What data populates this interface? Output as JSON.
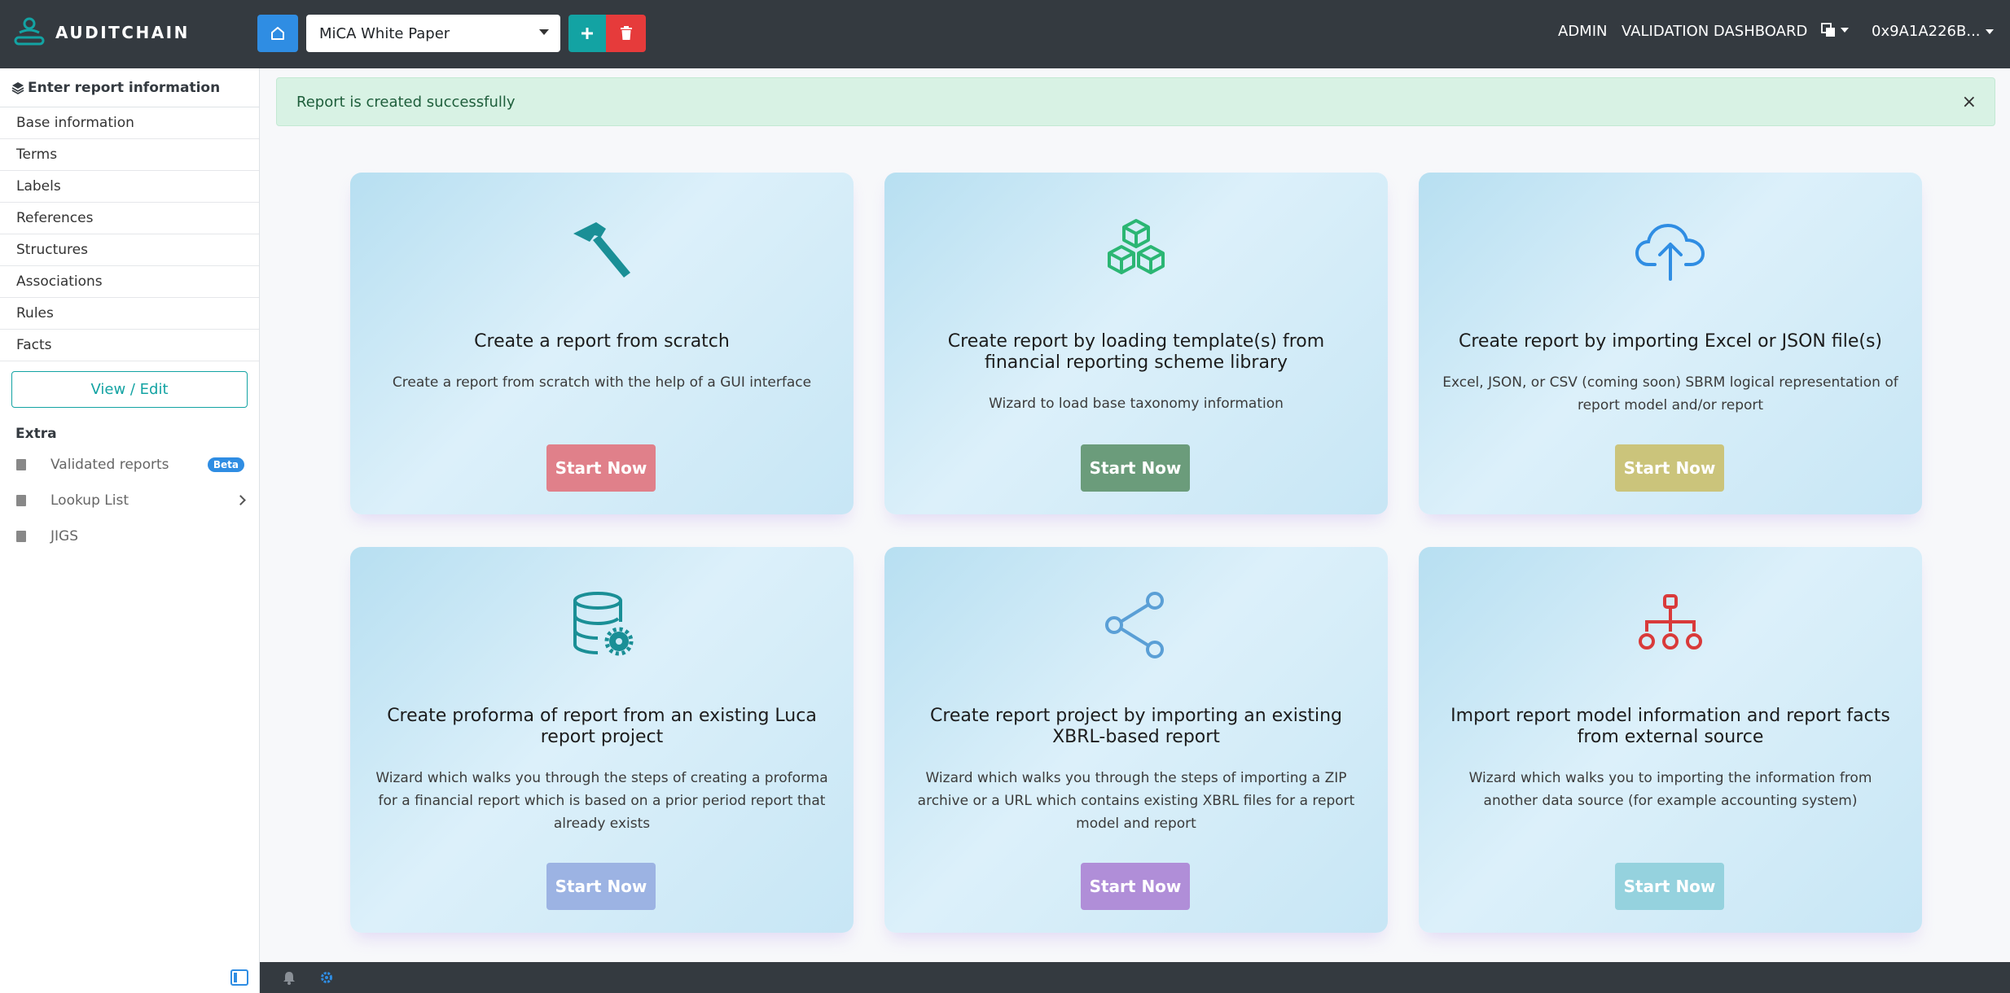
{
  "app": {
    "brand": "AUDITCHAIN"
  },
  "header": {
    "report_select": "MiCA White Paper",
    "nav": {
      "admin": "ADMIN",
      "validation": "VALIDATION DASHBOARD",
      "account": "0x9A1A226B..."
    }
  },
  "sidebar": {
    "heading": "Enter report information",
    "items": [
      {
        "label": "Base information"
      },
      {
        "label": "Terms"
      },
      {
        "label": "Labels"
      },
      {
        "label": "References"
      },
      {
        "label": "Structures"
      },
      {
        "label": "Associations"
      },
      {
        "label": "Rules"
      },
      {
        "label": "Facts"
      }
    ],
    "view_edit": "View / Edit",
    "extra_label": "Extra",
    "extra": [
      {
        "label": "Validated reports",
        "badge": "Beta"
      },
      {
        "label": "Lookup List"
      },
      {
        "label": "JIGS"
      }
    ]
  },
  "alert": {
    "message": "Report is created successfully",
    "close": "×"
  },
  "cards": [
    {
      "icon": "hammer-icon",
      "title": "Create a report from scratch",
      "desc": "Create a report from scratch with the help of a GUI interface",
      "button": "Start Now",
      "color": "#e0808a",
      "icon_color": "#1a8f96"
    },
    {
      "icon": "cubes-icon",
      "title": "Create report by loading template(s) from financial reporting scheme library",
      "desc": "Wizard to load base taxonomy information",
      "button": "Start Now",
      "color": "#6b9c7b",
      "icon_color": "#2bb673"
    },
    {
      "icon": "cloud-upload-icon",
      "title": "Create report by importing Excel or JSON file(s)",
      "desc": "Excel, JSON, or CSV (coming soon) SBRM logical representation of report model and/or report",
      "button": "Start Now",
      "color": "#cbc47b",
      "icon_color": "#2f8de3"
    },
    {
      "icon": "database-gear-icon",
      "title": "Create proforma of report from an existing Luca report project",
      "desc": "Wizard which walks you through the steps of creating a proforma for a financial report which is based on a prior period report that already exists",
      "button": "Start Now",
      "color": "#9cb3e3",
      "icon_color": "#1a8f96"
    },
    {
      "icon": "share-icon",
      "title": "Create report project by importing an existing XBRL-based report",
      "desc": "Wizard which walks you through the steps of importing a ZIP archive or a URL which contains existing XBRL files for a report model and report",
      "button": "Start Now",
      "color": "#b08ed8",
      "icon_color": "#5a9fd6"
    },
    {
      "icon": "sitemap-icon",
      "title": "Import report model information and report facts from external source",
      "desc": "Wizard which walks you to importing the information from another data source (for example accounting system)",
      "button": "Start Now",
      "color": "#95d2de",
      "icon_color": "#d93a3a"
    }
  ]
}
